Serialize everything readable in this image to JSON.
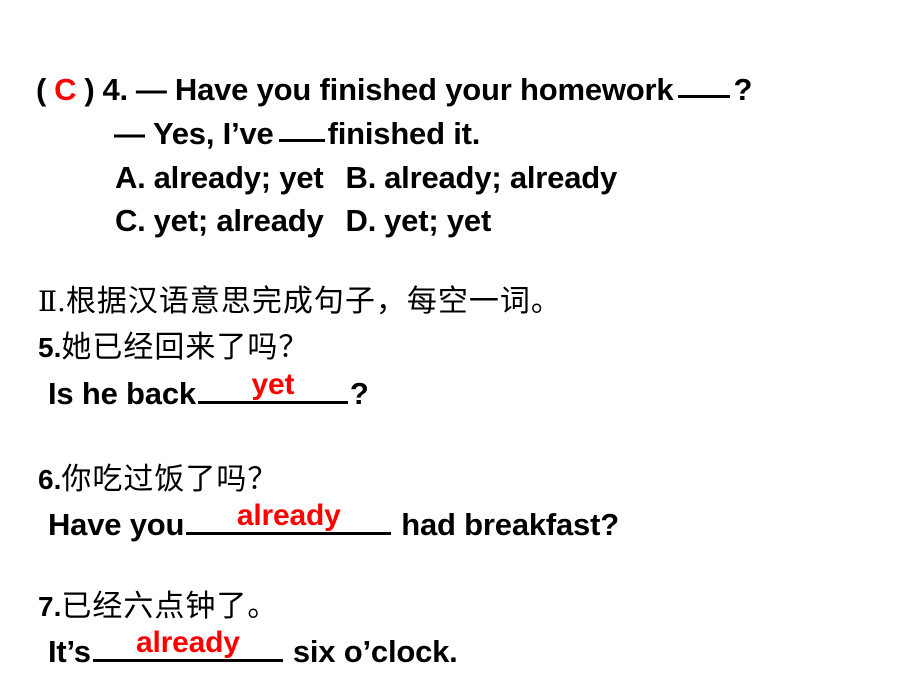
{
  "slide": {
    "background_color": "#ffffff",
    "answer_color": "#FF0000",
    "text_color": "#000000"
  },
  "question4": {
    "open_paren": "(",
    "answer_letter": "C",
    "close_paren": ")",
    "number": "4.",
    "prompt_dash": "—",
    "prompt_text": "Have you finished your homework",
    "prompt_tail": "?",
    "reply_dash": "—",
    "reply_head": "Yes, I’ve",
    "reply_tail": "finished it.",
    "options": [
      {
        "label": "A.",
        "text": "already; yet"
      },
      {
        "label": "B.",
        "text": "already; already"
      },
      {
        "label": "C.",
        "text": "yet; already"
      },
      {
        "label": "D.",
        "text": "yet; yet"
      }
    ]
  },
  "section2": {
    "roman": "Ⅱ",
    "roman_period": ".",
    "heading": "根据汉语意思完成句子，每空一词。"
  },
  "items": [
    {
      "number": "5.",
      "chinese": "她已经回来了吗？",
      "english_before": "Is he back",
      "answer": "yet",
      "english_after": "?"
    },
    {
      "number": "6.",
      "chinese": "你吃过饭了吗？",
      "english_before": "Have you",
      "answer": "already",
      "english_after": "had breakfast?"
    },
    {
      "number": "7.",
      "chinese": "已经六点钟了。",
      "english_before": "It’s",
      "answer": "already",
      "english_after": "six o’clock."
    }
  ]
}
